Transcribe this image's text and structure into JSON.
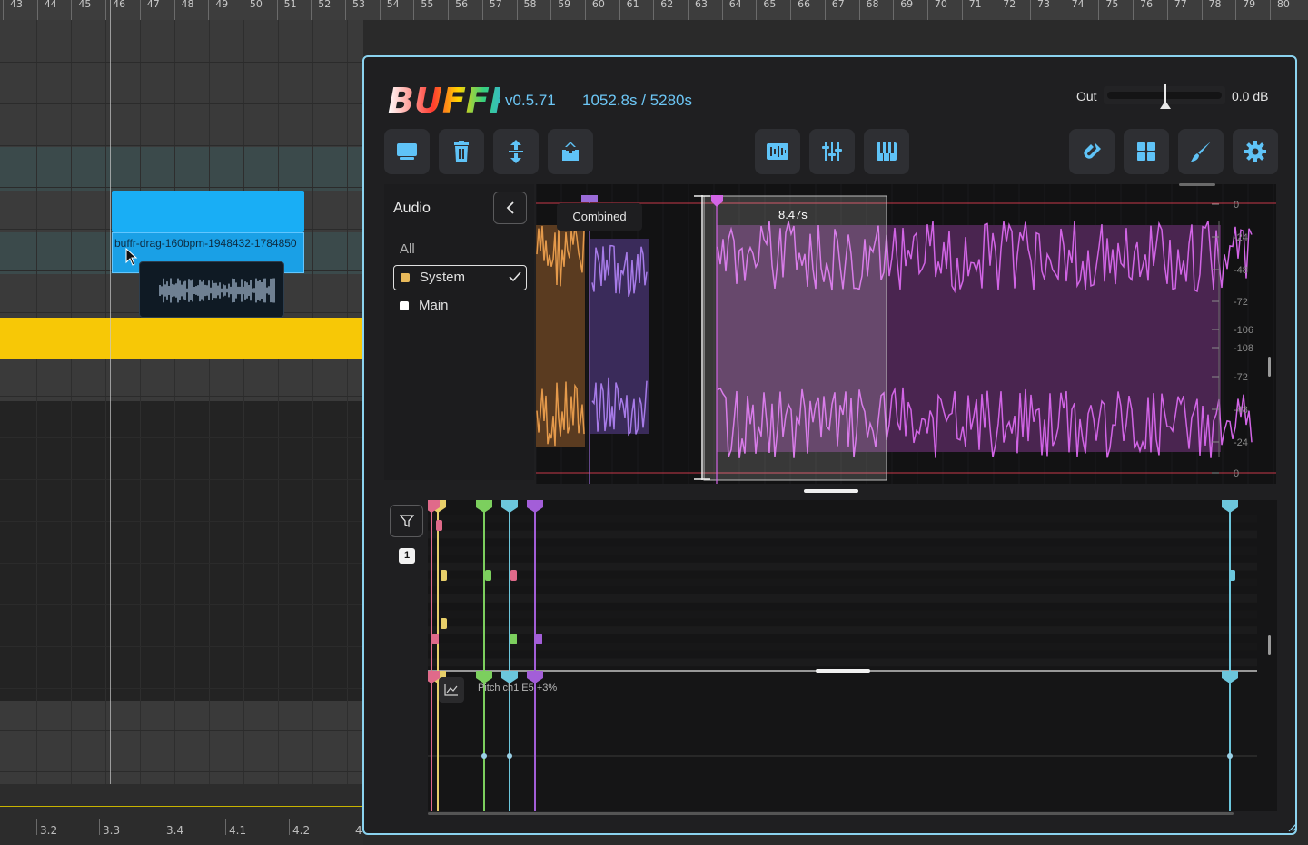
{
  "daw": {
    "ruler_numbers": [
      "43",
      "44",
      "45",
      "46",
      "47",
      "48",
      "49",
      "50",
      "51",
      "52",
      "53",
      "54",
      "55",
      "56",
      "57",
      "58",
      "59",
      "60",
      "61",
      "62",
      "63",
      "64",
      "65",
      "66",
      "67",
      "68",
      "69",
      "70",
      "71",
      "72",
      "73",
      "74",
      "75",
      "76",
      "77",
      "78",
      "79",
      "80"
    ],
    "clip_name": "buffr-drag-160bpm-1948432-1784850",
    "bottom_ruler_numbers": [
      "3.2",
      "3.3",
      "3.4",
      "4.1",
      "4.2",
      "4"
    ]
  },
  "plugin": {
    "logo_text": "BUFFR",
    "version": "v0.5.71",
    "timecode": "1052.8s / 5280s",
    "out_label": "Out",
    "out_value": "0.0 dB",
    "out_level": 0.5,
    "toolbar": {
      "left": [
        {
          "name": "monitor-icon"
        },
        {
          "name": "trash-icon"
        },
        {
          "name": "expand-vertical-icon"
        },
        {
          "name": "export-icon"
        }
      ],
      "center": [
        {
          "name": "waveform-icon"
        },
        {
          "name": "sliders-icon"
        },
        {
          "name": "piano-icon"
        }
      ],
      "right": [
        {
          "name": "magnet-icon"
        },
        {
          "name": "grid-icon"
        },
        {
          "name": "brush-icon"
        },
        {
          "name": "gear-icon"
        }
      ]
    },
    "audio_panel": {
      "title": "Audio",
      "all_label": "All",
      "items": [
        {
          "label": "System",
          "color": "#e8b95a",
          "selected": true
        },
        {
          "label": "Main",
          "color": "#ffffff",
          "selected": false
        }
      ]
    },
    "waveform": {
      "tooltip": "Combined",
      "selection_length": "8.47s",
      "db_scale_right": [
        "0",
        "-24",
        "-48",
        "-72",
        "-106",
        "-108",
        "-72",
        "-48",
        "-24",
        "0"
      ]
    },
    "events": {
      "page": "1",
      "pitch_label": "Pitch ch1 E5 +3%"
    },
    "colors": {
      "accent": "#6cc6f5",
      "border": "#8bd3ef",
      "clip_blue": "#19aef5",
      "track_yellow": "#f7c806",
      "wave_purple": "#c855d8",
      "wave_orange": "#d08a3a",
      "wave_violet": "#9a6bd8"
    }
  }
}
